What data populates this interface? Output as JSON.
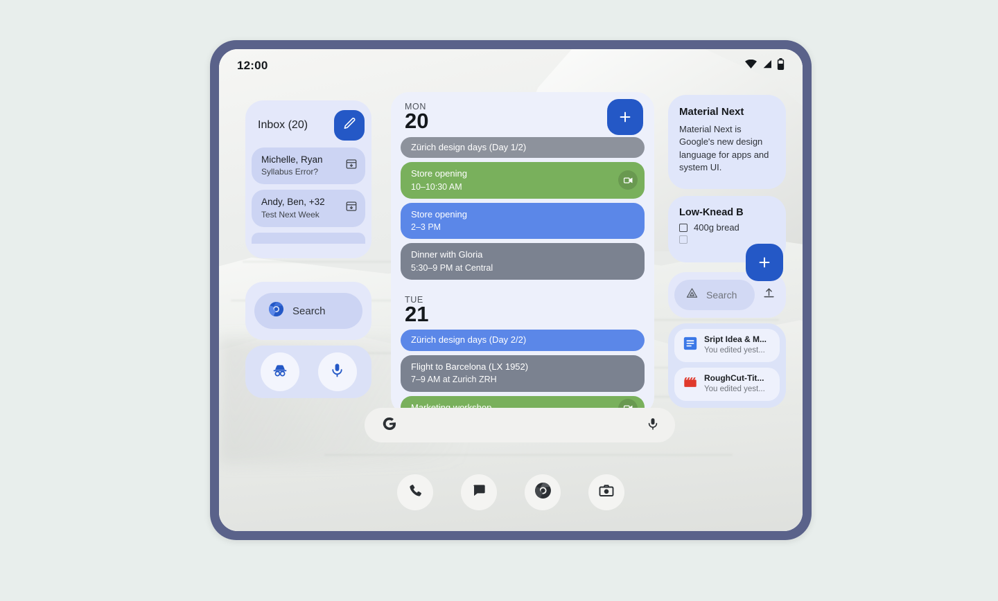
{
  "status_bar": {
    "clock": "12:00",
    "icons": [
      "wifi-icon",
      "cell-signal-icon",
      "battery-icon"
    ]
  },
  "widgets": {
    "inbox": {
      "title": "Inbox (20)",
      "compose_icon": "pencil-icon",
      "messages": [
        {
          "sender": "Michelle, Ryan",
          "subject": "Syllabus Error?",
          "action_icon": "archive-icon"
        },
        {
          "sender": "Andy, Ben, +32",
          "subject": "Test Next Week",
          "action_icon": "archive-icon"
        }
      ]
    },
    "chrome_search": {
      "placeholder": "Search",
      "logo_icon": "chrome-icon",
      "actions": [
        {
          "name": "incognito-button",
          "icon": "incognito-icon"
        },
        {
          "name": "voice-search-button",
          "icon": "microphone-icon"
        }
      ]
    },
    "calendar": {
      "add_event_icon": "plus-icon",
      "days": [
        {
          "dow": "MON",
          "date": "20",
          "events": [
            {
              "title": "Zürich design days (Day 1/2)",
              "subtitle": "",
              "color": "#8d929c",
              "badge": ""
            },
            {
              "title": "Store opening",
              "subtitle": "10–10:30 AM",
              "color": "#79b05c",
              "badge": "video-call-icon"
            },
            {
              "title": "Store opening",
              "subtitle": "2–3 PM",
              "color": "#5b87e8",
              "badge": ""
            },
            {
              "title": "Dinner with Gloria",
              "subtitle": "5:30–9 PM at Central",
              "color": "#7b8290",
              "badge": ""
            }
          ]
        },
        {
          "dow": "TUE",
          "date": "21",
          "events": [
            {
              "title": "Zürich design days (Day 2/2)",
              "subtitle": "",
              "color": "#5b87e8",
              "badge": ""
            },
            {
              "title": "Flight to Barcelona (LX 1952)",
              "subtitle": "7–9 AM at Zurich ZRH",
              "color": "#7b8290",
              "badge": ""
            },
            {
              "title": "Marketing workshop",
              "subtitle": "",
              "color": "#79b05c",
              "badge": "video-call-icon"
            }
          ]
        }
      ]
    },
    "keep_note": {
      "title": "Material Next",
      "body": "Material Next is Google's new design language for apps and system UI."
    },
    "keep_note_2": {
      "title": "Low-Knead B",
      "items": [
        "400g bread"
      ],
      "add_icon": "plus-icon"
    },
    "drive_search": {
      "logo_icon": "drive-icon",
      "placeholder": "Search",
      "upload_icon": "upload-icon"
    },
    "drive_files": [
      {
        "name": "Sript Idea & M...",
        "meta": "You edited yest...",
        "icon": "google-docs-icon",
        "icon_color": "#3b78e7"
      },
      {
        "name": "RoughCut-Tit...",
        "meta": "You edited yest...",
        "icon": "clapperboard-icon",
        "icon_color": "#e0392b"
      }
    ]
  },
  "search_bar": {
    "logo_icon": "google-g-icon",
    "mic_icon": "microphone-icon"
  },
  "dock": [
    {
      "name": "phone-app",
      "icon": "phone-icon"
    },
    {
      "name": "messages-app",
      "icon": "message-bubble-icon"
    },
    {
      "name": "chrome-app",
      "icon": "chrome-icon"
    },
    {
      "name": "camera-app",
      "icon": "camera-icon"
    }
  ],
  "colors": {
    "frame": "#5a628a",
    "accent_blue": "#2458c6",
    "widget_bg": "#e2e6f9",
    "page_bg": "#e8eeec"
  }
}
